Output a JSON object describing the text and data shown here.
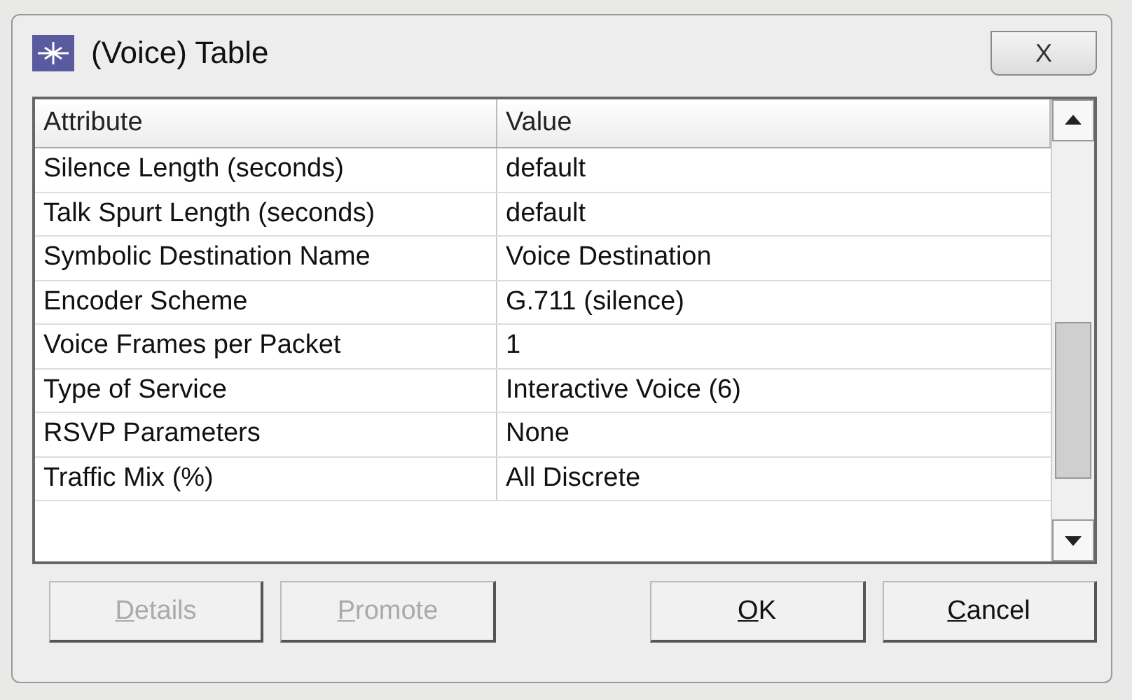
{
  "window": {
    "title": "(Voice) Table",
    "close": "X"
  },
  "table": {
    "columns": [
      "Attribute",
      "Value"
    ],
    "rows": [
      {
        "attribute": "Silence Length (seconds)",
        "value": "default"
      },
      {
        "attribute": "Talk Spurt Length (seconds)",
        "value": "default"
      },
      {
        "attribute": "Symbolic Destination Name",
        "value": "Voice Destination"
      },
      {
        "attribute": "Encoder Scheme",
        "value": "G.711 (silence)"
      },
      {
        "attribute": "Voice Frames per Packet",
        "value": "1"
      },
      {
        "attribute": "Type of Service",
        "value": "Interactive Voice (6)"
      },
      {
        "attribute": "RSVP Parameters",
        "value": "None"
      },
      {
        "attribute": "Traffic Mix (%)",
        "value": "All Discrete"
      }
    ]
  },
  "buttons": [
    {
      "label": "Details",
      "disabled": true
    },
    {
      "label": "Promote",
      "disabled": true
    },
    {
      "label": "OK",
      "disabled": false
    },
    {
      "label": "Cancel",
      "disabled": false
    }
  ]
}
